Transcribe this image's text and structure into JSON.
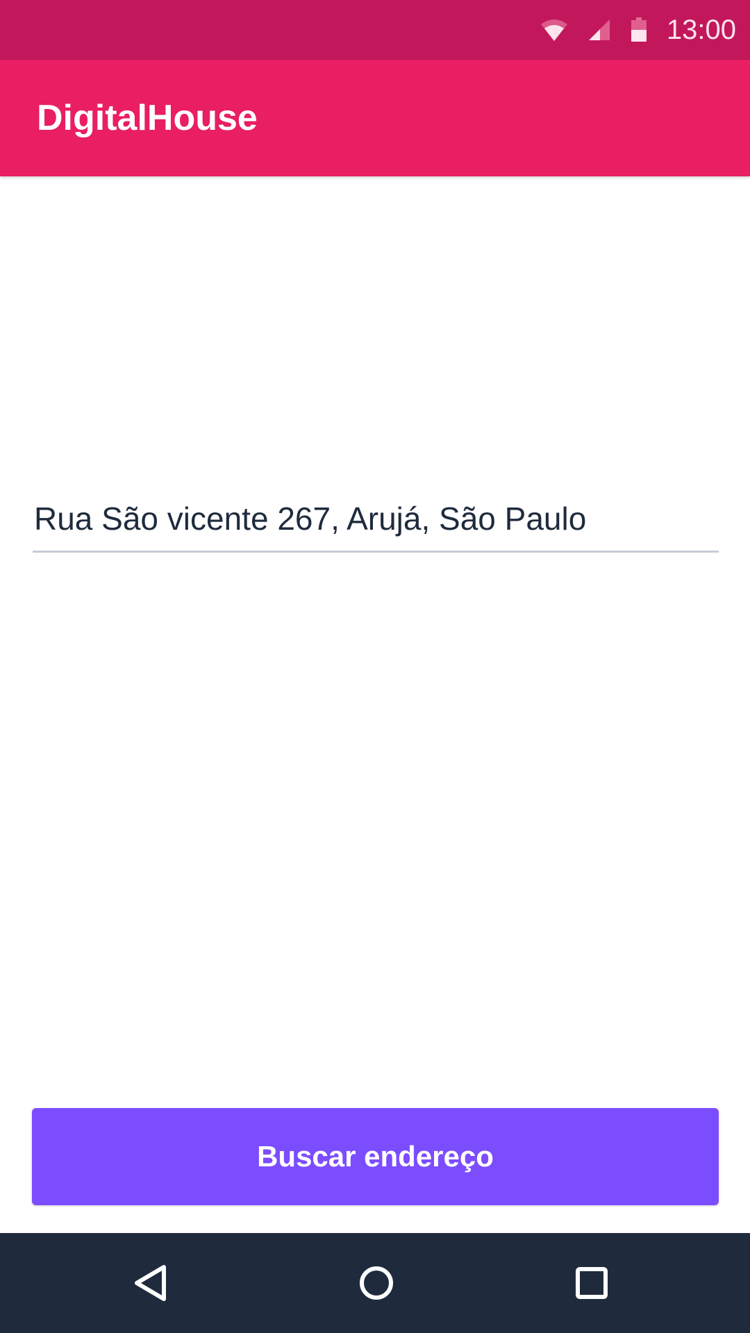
{
  "status_bar": {
    "time": "13:00",
    "icons": [
      "wifi-icon",
      "cell-signal-icon",
      "battery-icon"
    ]
  },
  "app_bar": {
    "title": "DigitalHouse"
  },
  "form": {
    "address_value": "Rua São vicente 267, Arujá, São Paulo"
  },
  "actions": {
    "search_label": "Buscar endereço"
  },
  "nav_bar": {
    "buttons": [
      "back-icon",
      "home-icon",
      "recents-icon"
    ]
  },
  "colors": {
    "status_bar": "#c2185b",
    "app_bar": "#e91e63",
    "button": "#7c4dff",
    "nav_bar": "#1f2b3d",
    "text": "#1f2b3d"
  }
}
